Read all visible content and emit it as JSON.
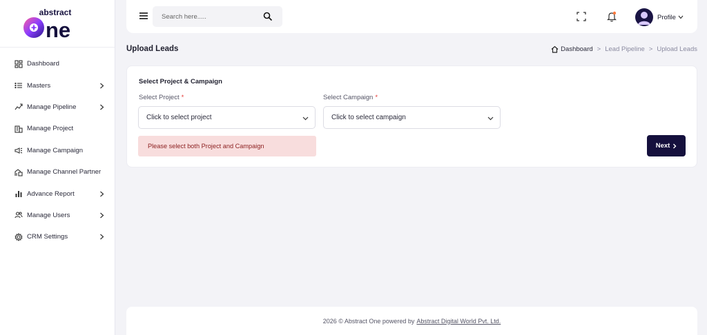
{
  "brand": {
    "logo_text_top": "abstract",
    "logo_text_main": "One",
    "accent": "#15103d"
  },
  "sidebar": {
    "items": [
      {
        "label": "Dashboard",
        "icon": "dashboard-icon",
        "has_children": false
      },
      {
        "label": "Masters",
        "icon": "list-icon",
        "has_children": true
      },
      {
        "label": "Manage Pipeline",
        "icon": "pipeline-icon",
        "has_children": true
      },
      {
        "label": "Manage Project",
        "icon": "building-icon",
        "has_children": false
      },
      {
        "label": "Manage Campaign",
        "icon": "megaphone-icon",
        "has_children": false
      },
      {
        "label": "Manage Channel Partner",
        "icon": "partner-icon",
        "has_children": false
      },
      {
        "label": "Advance Report",
        "icon": "bar-chart-icon",
        "has_children": true
      },
      {
        "label": "Manage Users",
        "icon": "users-icon",
        "has_children": true
      },
      {
        "label": "CRM Settings",
        "icon": "gear-icon",
        "has_children": true
      }
    ]
  },
  "topbar": {
    "search_placeholder": "Search here.....",
    "profile_label": "Profile"
  },
  "page": {
    "title": "Upload Leads",
    "breadcrumb": [
      "Dashboard",
      "Lead Pipeline",
      "Upload Leads"
    ],
    "breadcrumb_sep": ">"
  },
  "form": {
    "section_title": "Select Project & Campaign",
    "project_label": "Select Project",
    "project_value": "Click to select project",
    "campaign_label": "Select Campaign",
    "campaign_value": "Click to select campaign",
    "required_mark": "*",
    "alert": "Please select both Project and Campaign",
    "alert_color": "#f8dddd",
    "next_label": "Next"
  },
  "footer": {
    "text": "2026 © Abstract One powered by",
    "link": "Abstract Digital World Pvt. Ltd."
  }
}
